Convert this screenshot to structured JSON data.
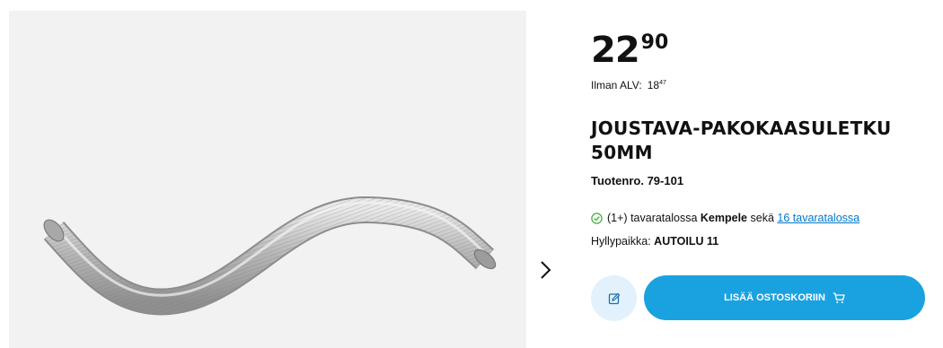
{
  "price": {
    "integer": "22",
    "decimals": "90"
  },
  "vat": {
    "label": "Ilman ALV:",
    "integer": "18",
    "decimals": "47"
  },
  "product": {
    "title": "JOUSTAVA-PAKOKAASULETKU 50MM",
    "sku": "Tuotenro. 79-101"
  },
  "stock": {
    "count": "(1+)",
    "text_store": "tavaratalossa",
    "store": "Kempele",
    "joiner": "sekä",
    "other_stores_link": "16 tavaratalossa"
  },
  "shelf": {
    "label": "Hyllypaikka:",
    "value": "AUTOILU 11"
  },
  "actions": {
    "add_to_cart": "LISÄÄ OSTOSKORIIN"
  },
  "icons": {
    "next": "chevron-right-icon",
    "check": "check-circle-icon",
    "note": "edit-note-icon",
    "cart": "cart-icon"
  },
  "colors": {
    "accent": "#1aa2e0",
    "note_bg": "#e2f1fb",
    "link": "#0078c8",
    "check": "#3cae3c"
  }
}
